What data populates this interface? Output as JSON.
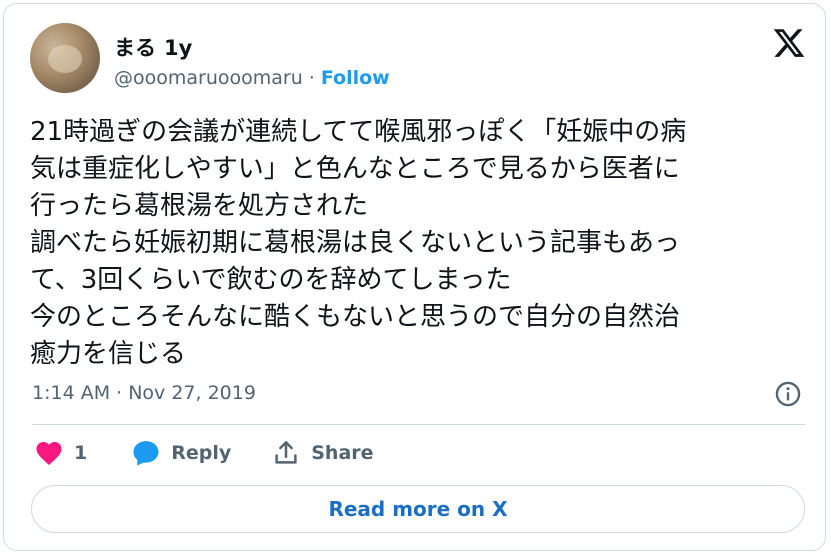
{
  "author": {
    "display_name": "まる",
    "age": "1y",
    "handle": "@ooomaruooomaru",
    "separator": "·",
    "follow_label": "Follow"
  },
  "tweet": {
    "lines": [
      "21時過ぎの会議が連続してて喉風邪っぽく「妊娠中の病",
      "気は重症化しやすい」と色んなところで見るから医者に",
      "行ったら葛根湯を処方された",
      "調べたら妊娠初期に葛根湯は良くないという記事もあっ",
      "て、3回くらいで飲むのを辞めてしまった",
      "今のところそんなに酷くもないと思うので自分の自然治",
      "癒力を信じる"
    ],
    "timestamp": "1:14 AM · Nov 27, 2019"
  },
  "actions": {
    "like_count": "1",
    "reply_label": "Reply",
    "share_label": "Share"
  },
  "footer": {
    "read_more_label": "Read more on X"
  },
  "icons": {
    "logo": "x-logo-icon",
    "info": "info-icon",
    "like": "heart-icon",
    "reply": "speech-bubble-icon",
    "share": "share-upload-icon"
  },
  "colors": {
    "like": "#f91880",
    "reply": "#1d9bf0",
    "link": "#1d9bf0",
    "muted": "#536471",
    "border": "#cfd9de"
  }
}
